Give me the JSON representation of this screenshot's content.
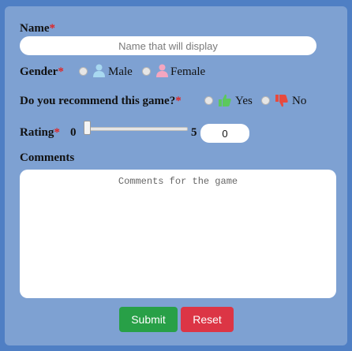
{
  "form": {
    "name_label": "Name",
    "required_mark": "*",
    "name_placeholder": "Name that will display",
    "name_value": "",
    "gender_label": "Gender",
    "gender_options": [
      {
        "label": "Male",
        "icon": "male-user-icon",
        "color": "#a8d8f0"
      },
      {
        "label": "Female",
        "icon": "female-user-icon",
        "color": "#f4a6c0"
      }
    ],
    "recommend_label": "Do you recommend this game?",
    "recommend_options": [
      {
        "label": "Yes",
        "icon": "thumbs-up-icon",
        "color": "#5cc85c"
      },
      {
        "label": "No",
        "icon": "thumbs-down-icon",
        "color": "#e84a3d"
      }
    ],
    "rating_label": "Rating",
    "rating_min": "0",
    "rating_max": "5",
    "rating_value": "0",
    "comments_label": "Comments",
    "comments_placeholder": "Comments for the game",
    "submit_label": "Submit",
    "reset_label": "Reset"
  },
  "colors": {
    "background": "#4f7fc4",
    "panel": "#7ea1d2",
    "required": "#e02424",
    "submit": "#28a047",
    "reset": "#dc3545"
  }
}
